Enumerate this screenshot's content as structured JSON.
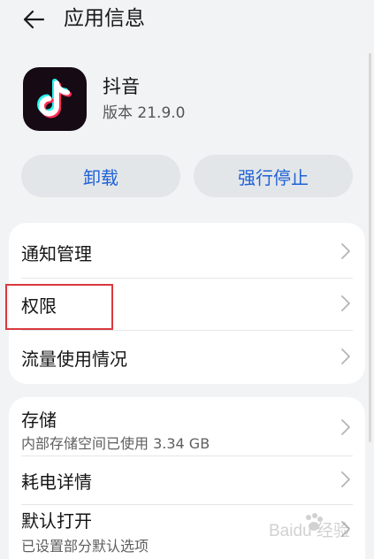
{
  "header": {
    "title": "应用信息",
    "back_icon": "arrow-left-icon"
  },
  "app": {
    "name": "抖音",
    "version": "版本 21.9.0",
    "icon": "tiktok-logo-icon"
  },
  "buttons": {
    "uninstall": "卸载",
    "force_stop": "强行停止"
  },
  "group1": [
    {
      "label": "通知管理"
    },
    {
      "label": "权限"
    },
    {
      "label": "流量使用情况"
    }
  ],
  "group2": [
    {
      "label": "存储",
      "sub": "内部存储空间已使用 3.34 GB"
    },
    {
      "label": "耗电详情"
    },
    {
      "label": "默认打开",
      "sub": "已设置部分默认选项"
    }
  ],
  "watermark": {
    "text": "Baidu 经验"
  },
  "colors": {
    "accent": "#1f62d6",
    "highlight": "#d9393e",
    "background": "#f1f3f5",
    "button_bg": "#e3e6e9"
  }
}
